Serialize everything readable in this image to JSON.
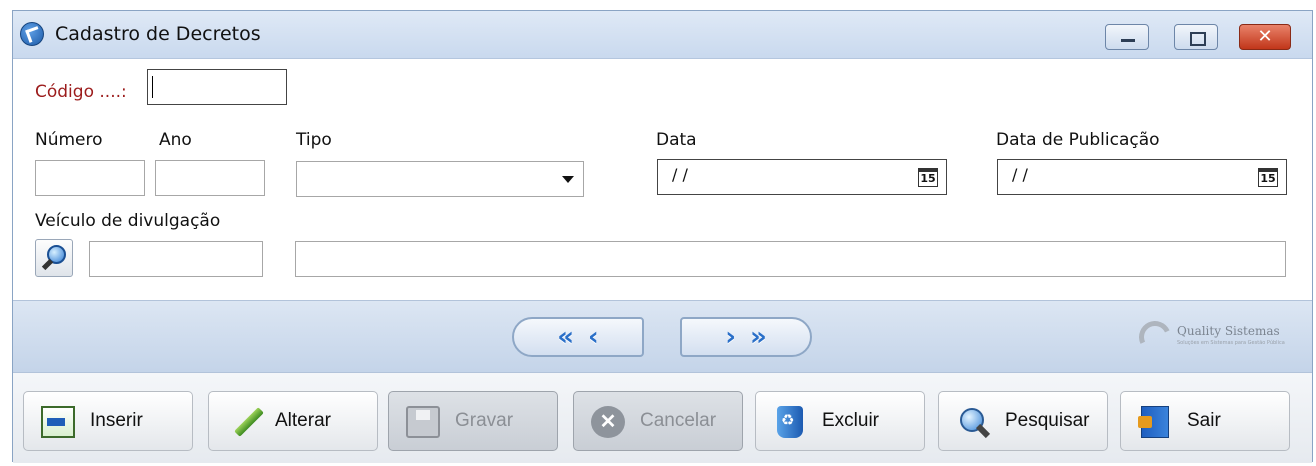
{
  "window": {
    "title": "Cadastro de Decretos",
    "close_glyph": "✕"
  },
  "form": {
    "codigo_label": "Código ....:",
    "codigo_value": "",
    "numero_label": "Número",
    "numero_value": "",
    "ano_label": "Ano",
    "ano_value": "",
    "tipo_label": "Tipo",
    "tipo_selected": "",
    "data_label": "Data",
    "data_value": "/ /",
    "data_publicacao_label": "Data de Publicação",
    "data_publicacao_value": "/ /",
    "calendar_icon_text": "15",
    "veiculo_label": "Veículo de divulgação",
    "veiculo_code": "",
    "veiculo_description": ""
  },
  "navigation": {
    "first_glyph": "«",
    "prev_glyph": "‹",
    "next_glyph": "›",
    "last_glyph": "»"
  },
  "brand": {
    "name": "Quality Sistemas",
    "tagline": "Soluções em Sistemas para Gestão Pública"
  },
  "toolbar": {
    "inserir": "Inserir",
    "alterar": "Alterar",
    "gravar": "Gravar",
    "cancelar": "Cancelar",
    "excluir": "Excluir",
    "pesquisar": "Pesquisar",
    "sair": "Sair"
  },
  "colors": {
    "required_label": "#9c1c1c",
    "nav_arrow": "#2a6fc8",
    "close_button": "#c1361a"
  },
  "icons": {
    "app": "app-logo-icon",
    "search": "magnifier-icon",
    "calendar": "calendar-icon"
  }
}
